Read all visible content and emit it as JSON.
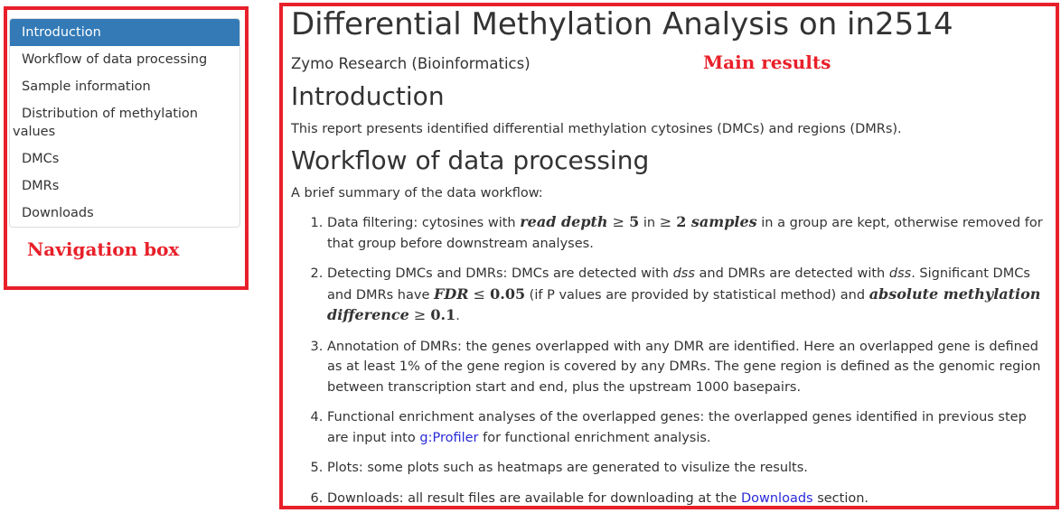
{
  "annotations": {
    "navigation_box": "Navigation box",
    "main_results": "Main results"
  },
  "toc": {
    "items": [
      {
        "label": "Introduction",
        "active": true
      },
      {
        "label": "Workflow of data processing"
      },
      {
        "label": "Sample information"
      },
      {
        "label": "Distribution of methylation values"
      },
      {
        "label": "DMCs"
      },
      {
        "label": "DMRs"
      },
      {
        "label": "Downloads"
      }
    ]
  },
  "header": {
    "title": "Differential Methylation Analysis on in2514",
    "author": "Zymo Research (Bioinformatics)"
  },
  "introduction": {
    "heading": "Introduction",
    "text": "This report presents identified differential methylation cytosines (DMCs) and regions (DMRs)."
  },
  "workflow": {
    "heading": "Workflow of data processing",
    "intro": "A brief summary of the data workflow:",
    "step1": {
      "pre": "Data filtering: cytosines with ",
      "math1": "read depth",
      "op1": " ≥ ",
      "num1": "5",
      "mid": " in ",
      "op2": "≥ ",
      "num2": "2",
      "math2": " samples",
      "post": " in a group are kept, otherwise removed for that group before downstream analyses."
    },
    "step2": {
      "pre": "Detecting DMCs and DMRs: DMCs are detected with ",
      "em1": "dss",
      "mid1": " and DMRs are detected with ",
      "em2": "dss",
      "mid2": ". Significant DMCs and DMRs have ",
      "math1": "FDR",
      "op1": " ≤ ",
      "num1": "0.05",
      "mid3": " (if P values are provided by statistical method) and ",
      "math2": "absolute methylation difference",
      "op2": " ≥ ",
      "num2": "0.1",
      "post": "."
    },
    "step3": "Annotation of DMRs: the genes overlapped with any DMR are identified. Here an overlapped gene is defined as at least 1% of the gene region is covered by any DMRs. The gene region is defined as the genomic region between transcription start and end, plus the upstream 1000 basepairs.",
    "step4": {
      "pre": "Functional enrichment analyses of the overlapped genes: the overlapped genes identified in previous step are input into ",
      "link": "g:Profiler",
      "post": " for functional enrichment analysis."
    },
    "step5": "Plots: some plots such as heatmaps are generated to visulize the results.",
    "step6": {
      "pre": "Downloads: all result files are available for downloading at the ",
      "link": "Downloads",
      "post": " section."
    }
  }
}
